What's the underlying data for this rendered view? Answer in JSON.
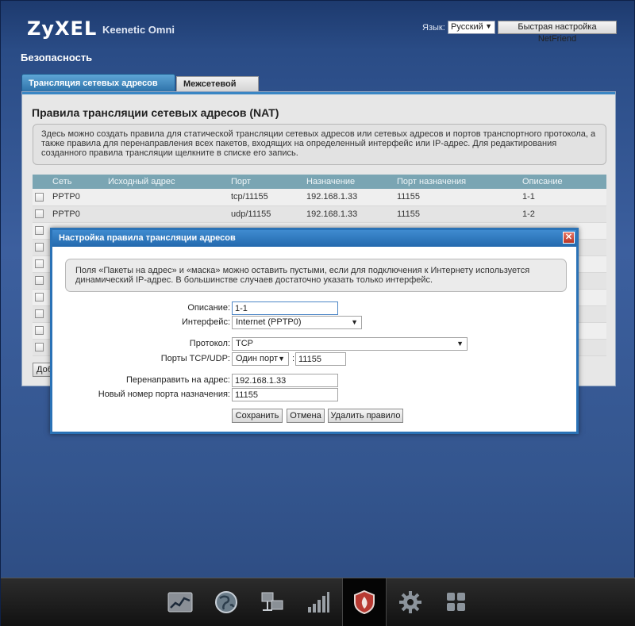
{
  "header": {
    "brand": "ZyXEL",
    "model": "Keenetic Omni",
    "language_label": "Язык:",
    "language_value": "Русский",
    "quick_setup": "Быстрая настройка NetFriend"
  },
  "page": {
    "section_title": "Безопасность",
    "tabs": [
      {
        "label": "Трансляция сетевых адресов (NAT)",
        "active": true
      },
      {
        "label": "Межсетевой экран",
        "active": false
      }
    ],
    "panel_heading": "Правила трансляции сетевых адресов (NAT)",
    "description": "Здесь можно создать правила для статической трансляции сетевых адресов или сетевых адресов и портов транспортного протокола, а также правила для перенаправления всех пакетов, входящих на определенный интерфейс или IP-адрес. Для редактирования созданного правила трансляции щелкните в списке его запись.",
    "table": {
      "headers": [
        "Сеть",
        "Исходный адрес",
        "Порт",
        "Назначение",
        "Порт назначения",
        "Описание"
      ],
      "rows": [
        [
          "PPTP0",
          "",
          "tcp/11155",
          "192.168.1.33",
          "11155",
          "1-1"
        ],
        [
          "PPTP0",
          "",
          "udp/11155",
          "192.168.1.33",
          "11155",
          "1-2"
        ]
      ]
    },
    "add_button": "Добавить"
  },
  "dialog": {
    "title": "Настройка правила трансляции адресов",
    "note": "Поля «Пакеты на адрес» и «маска» можно оставить пустыми, если для подключения к Интернету используется динамический IP-адрес. В большинстве случаев достаточно указать только интерфейс.",
    "fields": {
      "description_label": "Описание:",
      "description_value": "1-1",
      "interface_label": "Интерфейс:",
      "interface_value": "Internet (PPTP0)",
      "protocol_label": "Протокол:",
      "protocol_value": "TCP",
      "ports_label": "Порты TCP/UDP:",
      "ports_mode": "Один порт",
      "ports_separator": ":",
      "port_value": "11155",
      "redirect_label": "Перенаправить на адрес:",
      "redirect_value": "192.168.1.33",
      "dest_port_label": "Новый номер порта назначения:",
      "dest_port_value": "11155"
    },
    "buttons": {
      "save": "Сохранить",
      "cancel": "Отмена",
      "delete": "Удалить правило"
    }
  },
  "dock": {
    "items": [
      "chart-icon",
      "globe-icon",
      "network-icon",
      "signal-icon",
      "shield-icon",
      "gear-icon",
      "apps-icon"
    ],
    "active_index": 4
  }
}
